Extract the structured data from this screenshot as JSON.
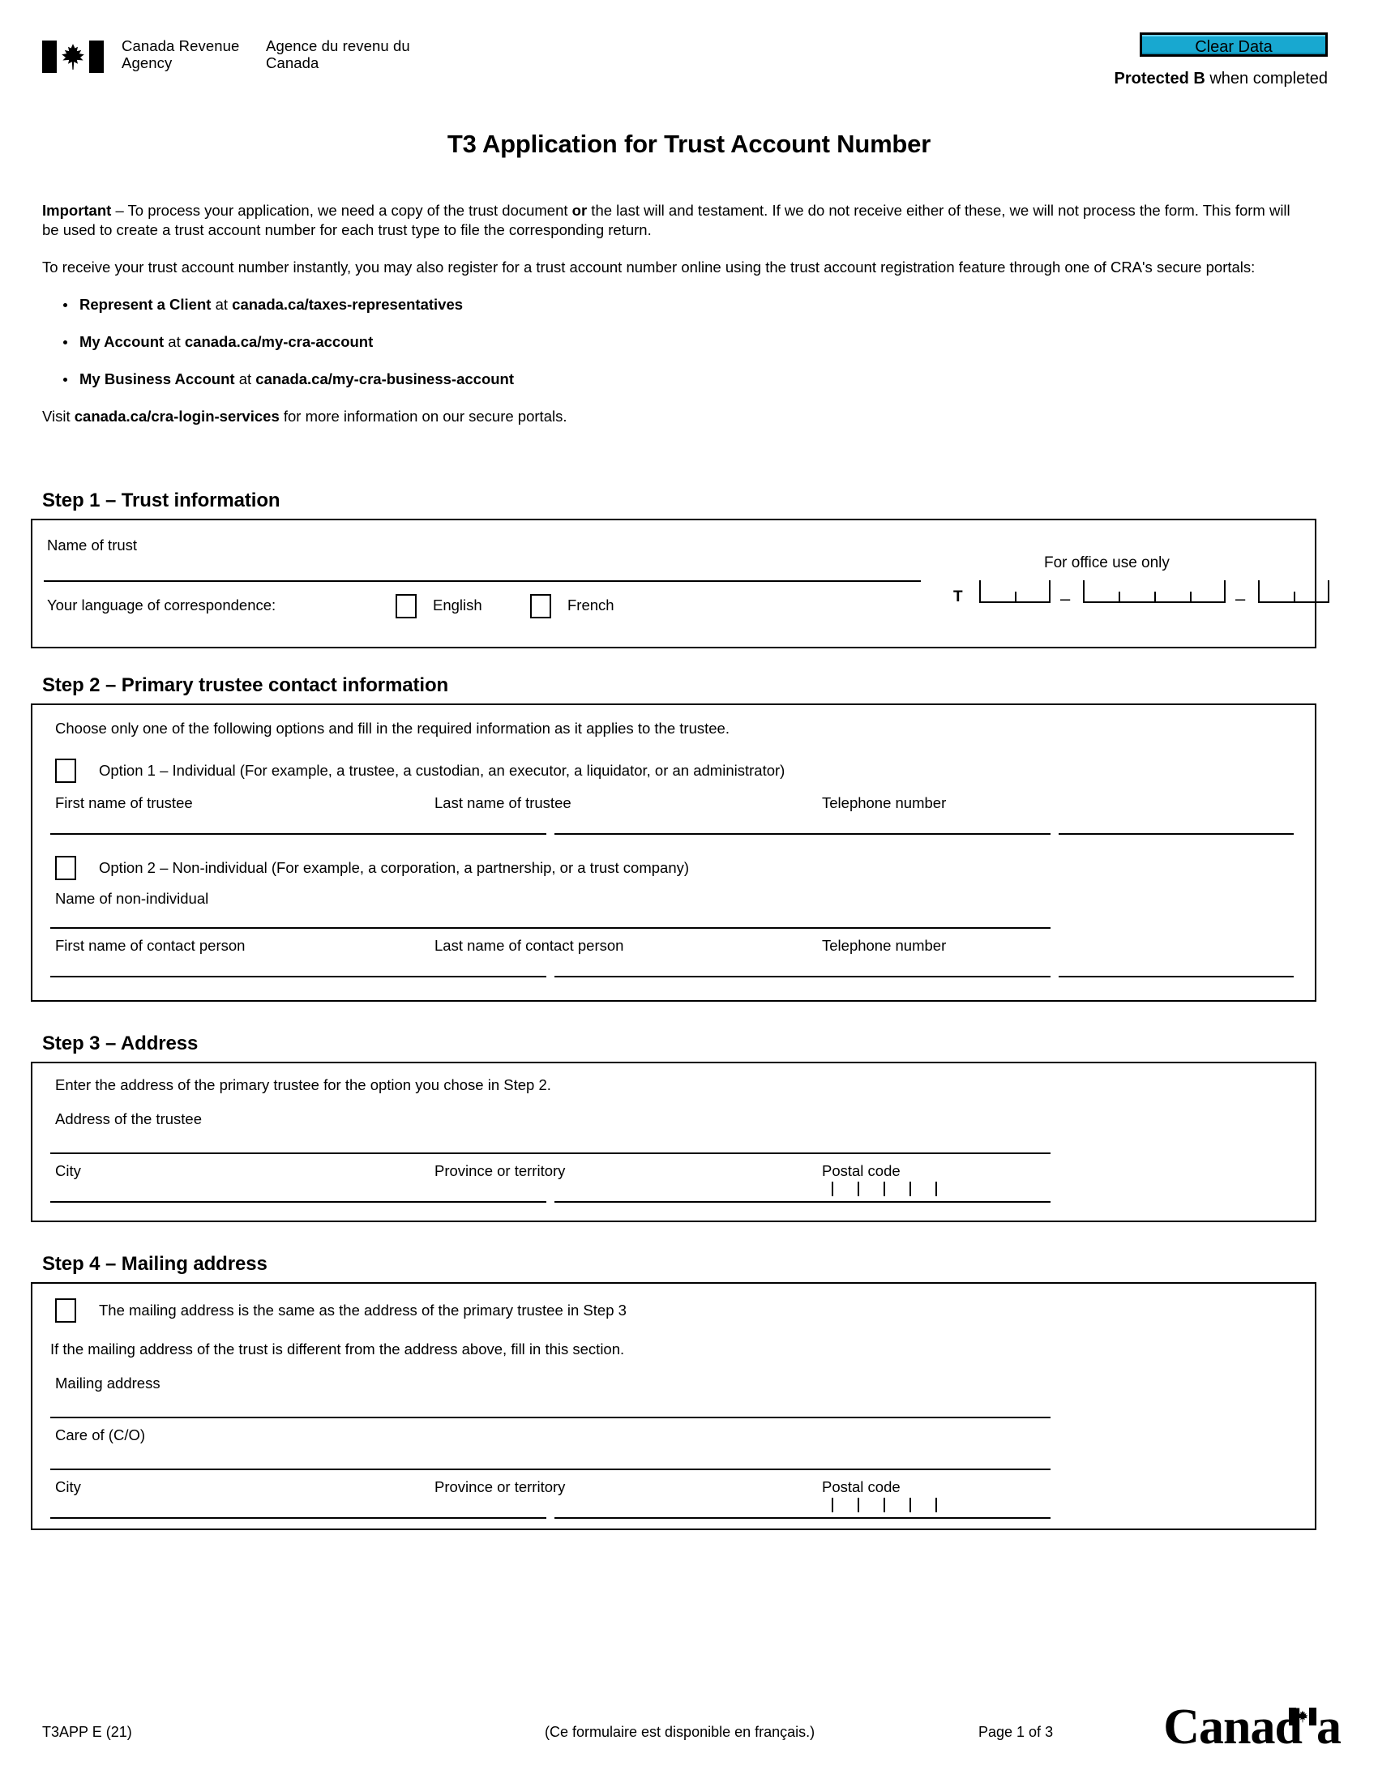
{
  "header": {
    "agency_en": "Canada Revenue Agency",
    "agency_fr": "Agence du revenu du Canada",
    "clear_data_label": "Clear Data",
    "protected_label": "Protected B",
    "protected_suffix": " when completed"
  },
  "title": "T3 Application for Trust Account Number",
  "intro": {
    "important_label": "Important",
    "important_dash": " – ",
    "important_text_1": "To process your application, we need a copy of the trust document ",
    "important_bold_or": "or",
    "important_text_2": " the last will and testament. If we do not receive either of these, we will not process the form. This form will be used to create a trust account number for each trust type to file the corresponding return.",
    "register_paragraph": "To receive your trust account number instantly, you may also register for a trust account number online using the trust account registration feature through one of CRA's secure portals:",
    "portals": [
      {
        "name": "Represent a Client",
        "at": " at ",
        "url": "canada.ca/taxes-representatives"
      },
      {
        "name": "My Account",
        "at": " at ",
        "url": "canada.ca/my-cra-account"
      },
      {
        "name": "My Business Account",
        "at": " at ",
        "url": "canada.ca/my-cra-business-account"
      }
    ],
    "visit_prefix": "Visit ",
    "visit_url": "canada.ca/cra-login-services",
    "visit_suffix": " for more information on our secure portals."
  },
  "step1": {
    "heading": "Step 1 – Trust information",
    "name_of_trust_label": "Name of trust",
    "language_label": "Your language of correspondence:",
    "english_label": "English",
    "french_label": "French",
    "office_use_label": "For office use only",
    "t_prefix": "T",
    "dash": "–"
  },
  "step2": {
    "heading": "Step 2 – Primary trustee contact information",
    "instruction": "Choose only one of the following options and fill in the required information as it applies to the trustee.",
    "option1_label": "Option 1 – Individual (For example, a trustee, a custodian, an executor, a liquidator, or an administrator)",
    "first_name_trustee_label": "First name of trustee",
    "last_name_trustee_label": "Last name of trustee",
    "telephone_label_1": "Telephone number",
    "option2_label": "Option 2 – Non-individual (For example, a corporation, a partnership, or a trust company)",
    "name_non_individual_label": "Name of non-individual",
    "first_name_contact_label": "First name of contact person",
    "last_name_contact_label": "Last name of contact person",
    "telephone_label_2": "Telephone number"
  },
  "step3": {
    "heading": "Step 3 – Address",
    "instruction": "Enter the address of the primary trustee for the option you chose in Step 2.",
    "address_label": "Address of the trustee",
    "city_label": "City",
    "province_label": "Province or territory",
    "postal_label": "Postal code"
  },
  "step4": {
    "heading": "Step 4 – Mailing address",
    "same_address_label": "The mailing address is the same as the address of the primary trustee in Step 3",
    "different_note": "If the mailing address of the trust is different from the address above, fill in this section.",
    "mailing_address_label": "Mailing address",
    "care_of_label": "Care of (C/O)",
    "city_label": "City",
    "province_label": "Province or territory",
    "postal_label": "Postal code"
  },
  "footer": {
    "form_code": "T3APP E (21)",
    "french_note": "(Ce formulaire est disponible en français.)",
    "page_number": "Page 1 of 3",
    "canada_wordmark": "Canad"
  },
  "colors": {
    "clear_data_fill": "#18a8d0",
    "ink": "#000000",
    "paper": "#ffffff"
  }
}
